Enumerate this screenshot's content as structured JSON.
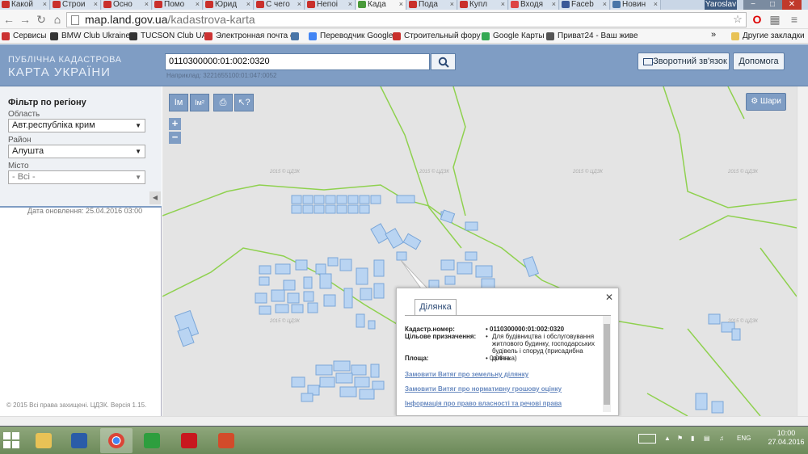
{
  "browser": {
    "tabs": [
      {
        "label": "Какой",
        "icon_color": "#c9302c"
      },
      {
        "label": "Строи",
        "icon_color": "#c9302c"
      },
      {
        "label": "Осно",
        "icon_color": "#c9302c"
      },
      {
        "label": "Помо",
        "icon_color": "#c9302c"
      },
      {
        "label": "Юрид",
        "icon_color": "#c9302c"
      },
      {
        "label": "С чего",
        "icon_color": "#c9302c"
      },
      {
        "label": "Непоі",
        "icon_color": "#c9302c"
      },
      {
        "label": "Када",
        "icon_color": "#4a9a3a",
        "active": true
      },
      {
        "label": "Пода",
        "icon_color": "#c9302c"
      },
      {
        "label": "Купл",
        "icon_color": "#c9302c"
      },
      {
        "label": "Входя",
        "icon_color": "#d44"
      },
      {
        "label": "Faceb",
        "icon_color": "#3b5998"
      },
      {
        "label": "Новин",
        "icon_color": "#4a76a8"
      }
    ],
    "user_badge": "Yaroslav",
    "url_host": "map.land.gov.ua",
    "url_path": "/kadastrova-karta",
    "bookmarks": [
      {
        "label": "Сервисы",
        "icon_color": "#c33"
      },
      {
        "label": "BMW Club Ukraine",
        "icon_color": "#333"
      },
      {
        "label": "TUCSON Club UA",
        "icon_color": "#333"
      },
      {
        "label": "Электронная почта с",
        "icon_color": "#c33"
      },
      {
        "label": "",
        "icon_color": "#4a76a8"
      },
      {
        "label": "Переводчик Google",
        "icon_color": "#4285f4"
      },
      {
        "label": "Строительный фору",
        "icon_color": "#c9302c"
      },
      {
        "label": "Google Карты",
        "icon_color": "#34a853"
      },
      {
        "label": "Приват24 - Ваш живе",
        "icon_color": "#555"
      }
    ],
    "other_bookmarks": "Другие закладки",
    "more_symbol": "»"
  },
  "header": {
    "logo_line1": "ПУБЛІЧНА КАДАСТРОВА",
    "logo_line2": "КАРТА УКРАЇНИ",
    "search_value": "0110300000:01:002:0320",
    "search_hint": "Наприклад: 3221655100:01:047:0052",
    "feedback_label": "Зворотний зв'язок",
    "help_label": "Допомога"
  },
  "sidebar": {
    "filter_title": "Фільтр по регіону",
    "region_label": "Область",
    "region_value": "Авт.республіка крим",
    "district_label": "Район",
    "district_value": "Алушта",
    "city_label": "Місто",
    "city_value": "- Всі -",
    "updated": "Дата оновлення: 25.04.2016 03:00",
    "copyright": "© 2015 Всі права захищені. ЦДЗК. Версія 1.15."
  },
  "map": {
    "layers_label": "Шари",
    "watermark": "2015 © ЦДЗК",
    "tool_labels": [
      "Iм",
      "Iм²"
    ]
  },
  "popup": {
    "tab": "Ділянка",
    "rows": [
      {
        "label": "Кадастр.номер:",
        "value": "0110300000:01:002:0320"
      },
      {
        "label": "Цільове призначення:",
        "value": "Для будівництва і обслуговування житлового будинку, господарських будівель і споруд (присадибна ділянка)"
      },
      {
        "label": "Площа:",
        "value": "0.04 га"
      }
    ],
    "links": [
      "Замовити Витяг про земельну ділянку",
      "Замовити Витяг про нормативну грошову оцінку",
      "Інформація про право власності та речові права"
    ]
  },
  "taskbar": {
    "lang": "ENG",
    "time": "10:00",
    "date": "27.04.2016"
  }
}
